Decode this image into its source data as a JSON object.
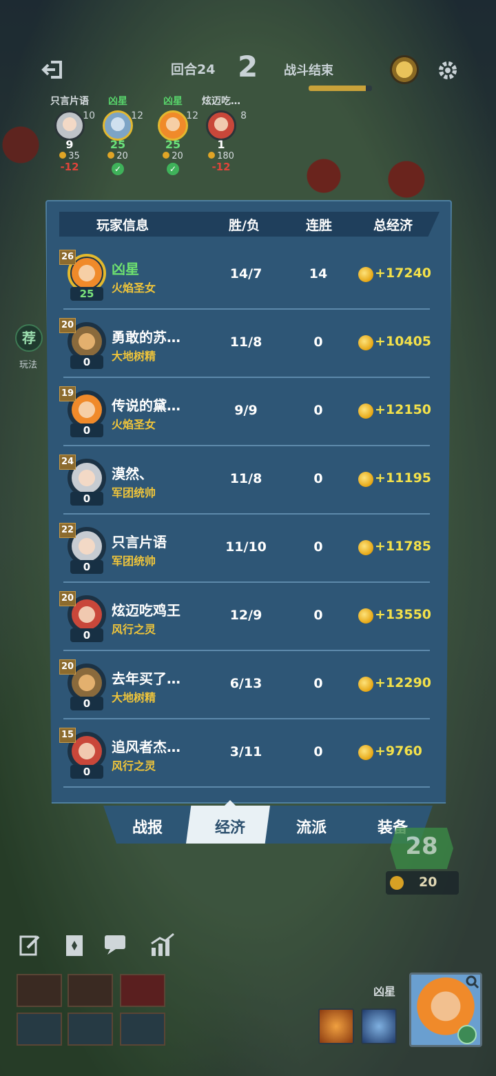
{
  "topbar": {
    "round_label": "回合24",
    "round_number": "2",
    "battle_status": "战斗结束",
    "progress_fraction": 0.9
  },
  "top_players": [
    {
      "name": "只言片语",
      "level": "10",
      "hp": "9",
      "gold": "35",
      "delta": "-12",
      "result": "lose"
    },
    {
      "name": "凶星",
      "level": "12",
      "hp": "25",
      "gold": "20",
      "delta": "",
      "result": "win"
    },
    {
      "name": "凶星",
      "level": "12",
      "hp": "25",
      "gold": "20",
      "delta": "",
      "result": "win"
    },
    {
      "name": "炫迈吃…",
      "level": "8",
      "hp": "1",
      "gold": "180",
      "delta": "-12",
      "result": "lose"
    }
  ],
  "side": {
    "badge": "荐",
    "label": "玩法"
  },
  "table": {
    "headers": {
      "player": "玩家信息",
      "winloss": "胜/负",
      "streak": "连胜",
      "economy": "总经济"
    },
    "rows": [
      {
        "level": "26",
        "hp": "25",
        "name": "凶星",
        "hero": "火焰圣女",
        "winloss": "14/7",
        "streak": "14",
        "economy": "+17240",
        "self": true
      },
      {
        "level": "20",
        "hp": "0",
        "name": "勇敢的苏…",
        "hero": "大地树精",
        "winloss": "11/8",
        "streak": "0",
        "economy": "+10405"
      },
      {
        "level": "19",
        "hp": "0",
        "name": "传说的黛…",
        "hero": "火焰圣女",
        "winloss": "9/9",
        "streak": "0",
        "economy": "+12150"
      },
      {
        "level": "24",
        "hp": "0",
        "name": "漠然、",
        "hero": "军团统帅",
        "winloss": "11/8",
        "streak": "0",
        "economy": "+11195"
      },
      {
        "level": "22",
        "hp": "0",
        "name": "只言片语",
        "hero": "军团统帅",
        "winloss": "11/10",
        "streak": "0",
        "economy": "+11785"
      },
      {
        "level": "20",
        "hp": "0",
        "name": "炫迈吃鸡王",
        "hero": "风行之灵",
        "winloss": "12/9",
        "streak": "0",
        "economy": "+13550"
      },
      {
        "level": "20",
        "hp": "0",
        "name": "去年买了…",
        "hero": "大地树精",
        "winloss": "6/13",
        "streak": "0",
        "economy": "+12290"
      },
      {
        "level": "15",
        "hp": "0",
        "name": "追风者杰…",
        "hero": "风行之灵",
        "winloss": "3/11",
        "streak": "0",
        "economy": "+9760"
      }
    ]
  },
  "tabs": [
    "战报",
    "经济",
    "流派",
    "装备"
  ],
  "active_tab": "经济",
  "bottom": {
    "level": "28",
    "gold": "20",
    "ally_name": "凶星"
  },
  "colors": {
    "panel": "#2e5676",
    "header": "#1f3f5c",
    "gold_text": "#f4e14a",
    "hero_text": "#f0c53a",
    "self_name": "#6ee06f"
  }
}
